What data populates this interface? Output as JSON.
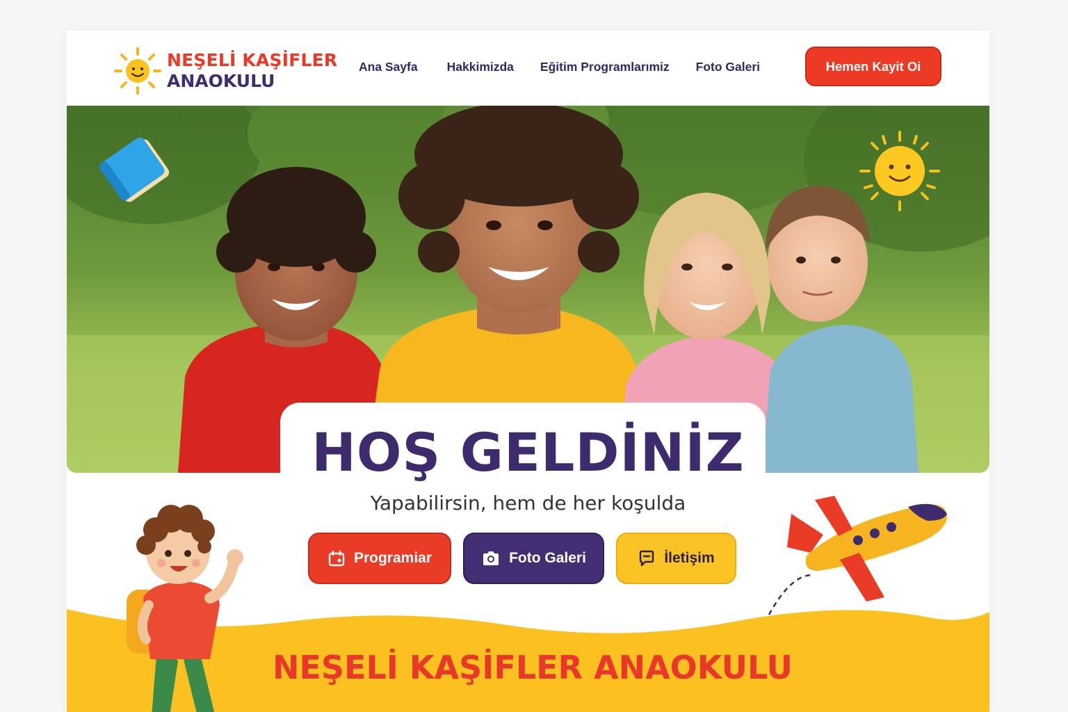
{
  "brand": {
    "line1": "NEŞELİ KAŞİFLER",
    "line2": "ANAOKULU",
    "logo_icon": "sun-face-icon"
  },
  "nav": {
    "items": [
      {
        "label": "Ana Sayfa"
      },
      {
        "label": "Hakkimizda"
      },
      {
        "label": "Eğitim Programlarımiz"
      },
      {
        "label": "Foto Galeri"
      }
    ],
    "cta_label": "Hemen Kayit Oi"
  },
  "hero": {
    "title": "HOŞ GELDİNİZ",
    "subtitle": "Yapabilirsin, hem de her koşulda"
  },
  "actions": [
    {
      "label": "Programiar",
      "icon": "calendar-icon",
      "color": "#ea3b26"
    },
    {
      "label": "Foto Galeri",
      "icon": "camera-icon",
      "color": "#432e74"
    },
    {
      "label": "İletişim",
      "icon": "chat-icon",
      "color": "#fbc424"
    }
  ],
  "footer_banner": {
    "title": "NEŞELİ KAŞİFLER ANAOKULU"
  },
  "colors": {
    "accent_red": "#ec3a24",
    "accent_purple": "#3d2b6d",
    "accent_yellow": "#fbc424"
  }
}
